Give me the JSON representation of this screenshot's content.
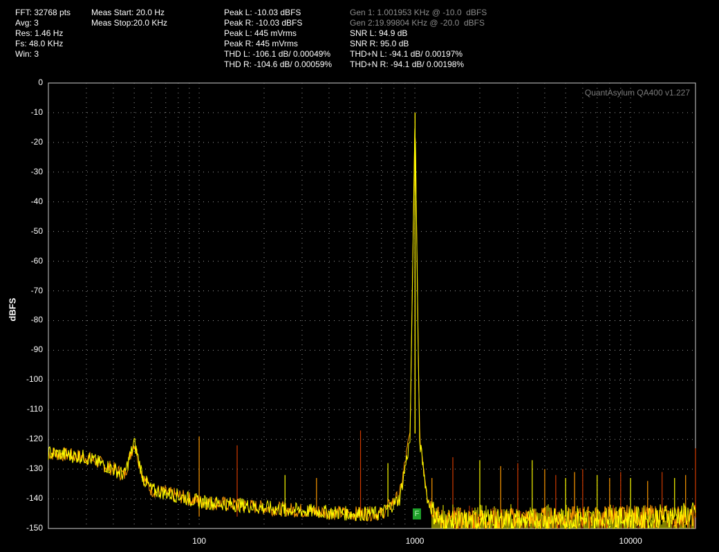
{
  "info": {
    "col1": [
      "FFT: 32768 pts",
      "Avg: 3",
      "Res: 1.46 Hz",
      "Fs: 48.0 KHz",
      "Win: 3"
    ],
    "col2": [
      "Meas Start: 20.0 Hz",
      "Meas Stop:20.0 KHz"
    ],
    "col3": [
      "Peak L: -10.03 dBFS",
      "Peak R: -10.03 dBFS",
      "Peak L: 445 mVrms",
      "Peak R: 445 mVrms",
      "THD L: -106.1 dB/ 0.00049%",
      "THD R: -104.6 dB/ 0.00059%"
    ],
    "col4_gray": [
      "Gen 1: 1.001953 KHz @ -10.0  dBFS",
      "Gen 2:19.99804 KHz @ -20.0  dBFS"
    ],
    "col4": [
      "SNR L: 94.9 dB",
      "SNR R: 95.0 dB",
      "THD+N L: -94.1 dB/ 0.00197%",
      "THD+N R: -94.1 dB/ 0.00198%"
    ]
  },
  "watermark": "QuantAsylum QA400 v1.227",
  "marker_label": "F",
  "colors": {
    "background": "#000000",
    "grid": "#9a9a9a",
    "left_channel": "#ffff00",
    "right_channel": "#ff9a00",
    "marker": "#1fa02a"
  },
  "chart_data": {
    "type": "line",
    "xscale": "log",
    "xlim": [
      20,
      20000
    ],
    "ylim": [
      -150,
      0
    ],
    "ylabel": "dBFS",
    "xticks": [
      100,
      1000,
      10000
    ],
    "xtick_labels": [
      "100",
      "1000",
      "10000"
    ],
    "yticks": [
      0,
      -10,
      -20,
      -30,
      -40,
      -50,
      -60,
      -70,
      -80,
      -90,
      -100,
      -110,
      -120,
      -130,
      -140,
      -150
    ],
    "grid": true,
    "series": [
      {
        "channel": "R",
        "color": "#ff9a00",
        "x": [
          20,
          30,
          40,
          45,
          50,
          55,
          60,
          80,
          100,
          150,
          200,
          300,
          500,
          700,
          850,
          950,
          1002,
          1050,
          1150,
          1300,
          2000,
          5000,
          10000,
          20000
        ],
        "y": [
          -124.5,
          -126,
          -130,
          -132,
          -121,
          -133,
          -137,
          -139,
          -141,
          -142,
          -143,
          -144,
          -145,
          -145,
          -139,
          -118,
          -10,
          -118,
          -140,
          -147,
          -147,
          -146.5,
          -146,
          -146
        ]
      },
      {
        "channel": "L",
        "color": "#ffff00",
        "x": [
          20,
          30,
          40,
          45,
          50,
          55,
          60,
          80,
          100,
          150,
          200,
          300,
          500,
          700,
          850,
          950,
          1002,
          1050,
          1150,
          1300,
          2000,
          5000,
          10000,
          20000
        ],
        "y": [
          -124.5,
          -126,
          -130,
          -132,
          -121,
          -133,
          -137,
          -139,
          -141,
          -142,
          -143,
          -144,
          -145,
          -145,
          -140,
          -120,
          -10,
          -120,
          -141,
          -148,
          -147.5,
          -147,
          -146.5,
          -145
        ]
      }
    ],
    "spurs": [
      {
        "f": 100,
        "db": -119
      },
      {
        "f": 150,
        "db": -122
      },
      {
        "f": 250,
        "db": -132
      },
      {
        "f": 350,
        "db": -133
      },
      {
        "f": 560,
        "db": -117
      },
      {
        "f": 750,
        "db": -128
      },
      {
        "f": 1200,
        "db": -133
      },
      {
        "f": 1500,
        "db": -126
      },
      {
        "f": 2000,
        "db": -127
      },
      {
        "f": 2500,
        "db": -129
      },
      {
        "f": 3000,
        "db": -128
      },
      {
        "f": 3500,
        "db": -127
      },
      {
        "f": 4000,
        "db": -130
      },
      {
        "f": 4500,
        "db": -132
      },
      {
        "f": 5000,
        "db": -133
      },
      {
        "f": 5500,
        "db": -131
      },
      {
        "f": 6000,
        "db": -130
      },
      {
        "f": 7000,
        "db": -132
      },
      {
        "f": 8000,
        "db": -133
      },
      {
        "f": 9000,
        "db": -131
      },
      {
        "f": 10000,
        "db": -133
      },
      {
        "f": 12000,
        "db": -134
      },
      {
        "f": 14000,
        "db": -131
      },
      {
        "f": 16000,
        "db": -133
      },
      {
        "f": 18000,
        "db": -132
      },
      {
        "f": 20000,
        "db": -123
      }
    ]
  }
}
